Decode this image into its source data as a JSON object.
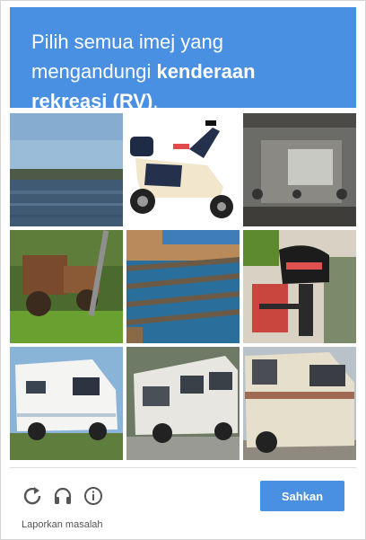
{
  "header": {
    "line_plain": "Pilih semua imej yang mengandungi ",
    "line_bold": "kenderaan rekreasi (RV)",
    "line_end": "."
  },
  "tiles": [
    {
      "name": "tile-lake"
    },
    {
      "name": "tile-toy-motorbike"
    },
    {
      "name": "tile-engine-block"
    },
    {
      "name": "tile-old-tractor"
    },
    {
      "name": "tile-stadium-seats"
    },
    {
      "name": "tile-outboard-motor"
    },
    {
      "name": "tile-white-rv"
    },
    {
      "name": "tile-white-van"
    },
    {
      "name": "tile-beige-camper"
    }
  ],
  "controls": {
    "reload_icon": "reload-icon",
    "audio_icon": "headphones-icon",
    "info_icon": "info-icon"
  },
  "verify_label": "Sahkan",
  "report_label": "Laporkan masalah",
  "colors": {
    "accent": "#4a90e2"
  }
}
